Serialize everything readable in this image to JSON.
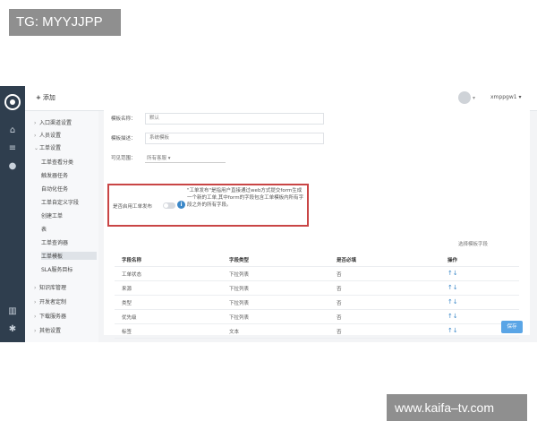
{
  "watermarks": {
    "top": "TG: MYYJJPP",
    "bottom": "www.kaifa–tv.com"
  },
  "topbar": {
    "add_label": "添加",
    "user_name": "xmppgw1"
  },
  "sidebar": {
    "items": [
      {
        "label": "入口渠道设置"
      },
      {
        "label": "人员设置"
      },
      {
        "label": "工单设置"
      },
      {
        "label": "知识库管理"
      },
      {
        "label": "开发者定制"
      },
      {
        "label": "下载服务器"
      },
      {
        "label": "其他设置"
      }
    ],
    "sub_items": [
      {
        "label": "工单查看分类"
      },
      {
        "label": "触发器任务"
      },
      {
        "label": "自动化任务"
      },
      {
        "label": "工单自定义字段"
      },
      {
        "label": "创建工单"
      },
      {
        "label": "表"
      },
      {
        "label": "工单查询器"
      },
      {
        "label": "工单模板"
      },
      {
        "label": "SLA服务目标"
      }
    ]
  },
  "form": {
    "template_name_label": "模板名称：",
    "template_name_value": "默认",
    "template_desc_label": "模板描述：",
    "template_desc_value": "系统模板",
    "scope_label": "可见范围：",
    "scope_value": "所有客服",
    "toggle_label": "是否启用工单发布",
    "info_icon_glyph": "i",
    "tip_text": "\"工单发布\"是指用户直接通过web方式提交form生成一个新的工单,其中form的字段包含工单模板内所有字段之外的所有字段。"
  },
  "table": {
    "select_fields_link": "选择模板字段",
    "columns": [
      "字段名称",
      "字段类型",
      "是否必填",
      "操作"
    ],
    "rows": [
      {
        "name": "工单状态",
        "type": "下拉列表",
        "required": "否",
        "ops": "↑↓"
      },
      {
        "name": "来源",
        "type": "下拉列表",
        "required": "否",
        "ops": "↑↓"
      },
      {
        "name": "类型",
        "type": "下拉列表",
        "required": "否",
        "ops": "↑↓"
      },
      {
        "name": "优先级",
        "type": "下拉列表",
        "required": "否",
        "ops": "↑↓"
      },
      {
        "name": "标签",
        "type": "文本",
        "required": "否",
        "ops": "↑↓"
      }
    ]
  },
  "actions": {
    "save_label": "保存"
  },
  "colors": {
    "rail": "#2f3e4e",
    "accent": "#3a87c8",
    "highlight_border": "#c94545",
    "save_button": "#5aa5e6"
  }
}
